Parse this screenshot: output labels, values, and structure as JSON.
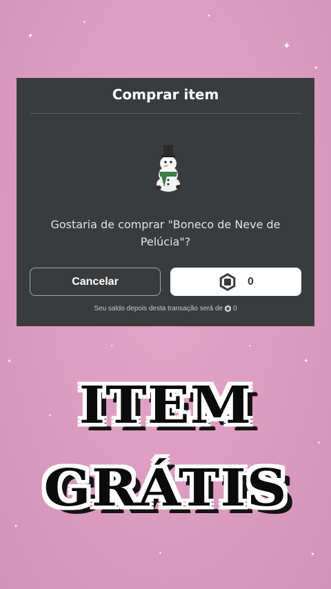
{
  "dialog": {
    "title": "Comprar item",
    "item_name": "Boneco de Neve de Pelúcia",
    "question": "Gostaria de comprar \"Boneco de Neve de Pelúcia\"?",
    "cancel_label": "Cancelar",
    "price": "0",
    "balance_note_prefix": "Seu saldo depois desta transação será de",
    "balance_after": "0",
    "icons": {
      "currency": "robux-icon",
      "item": "snowman-plush-icon"
    }
  },
  "banner": {
    "line1": "ITEM",
    "line2": "GRÁTIS"
  },
  "colors": {
    "background": "#dc9cc0",
    "dialog_bg": "#393b3d",
    "buy_button_bg": "#ffffff",
    "banner_text": "#0b0b0b",
    "banner_outline": "#ffffff"
  }
}
